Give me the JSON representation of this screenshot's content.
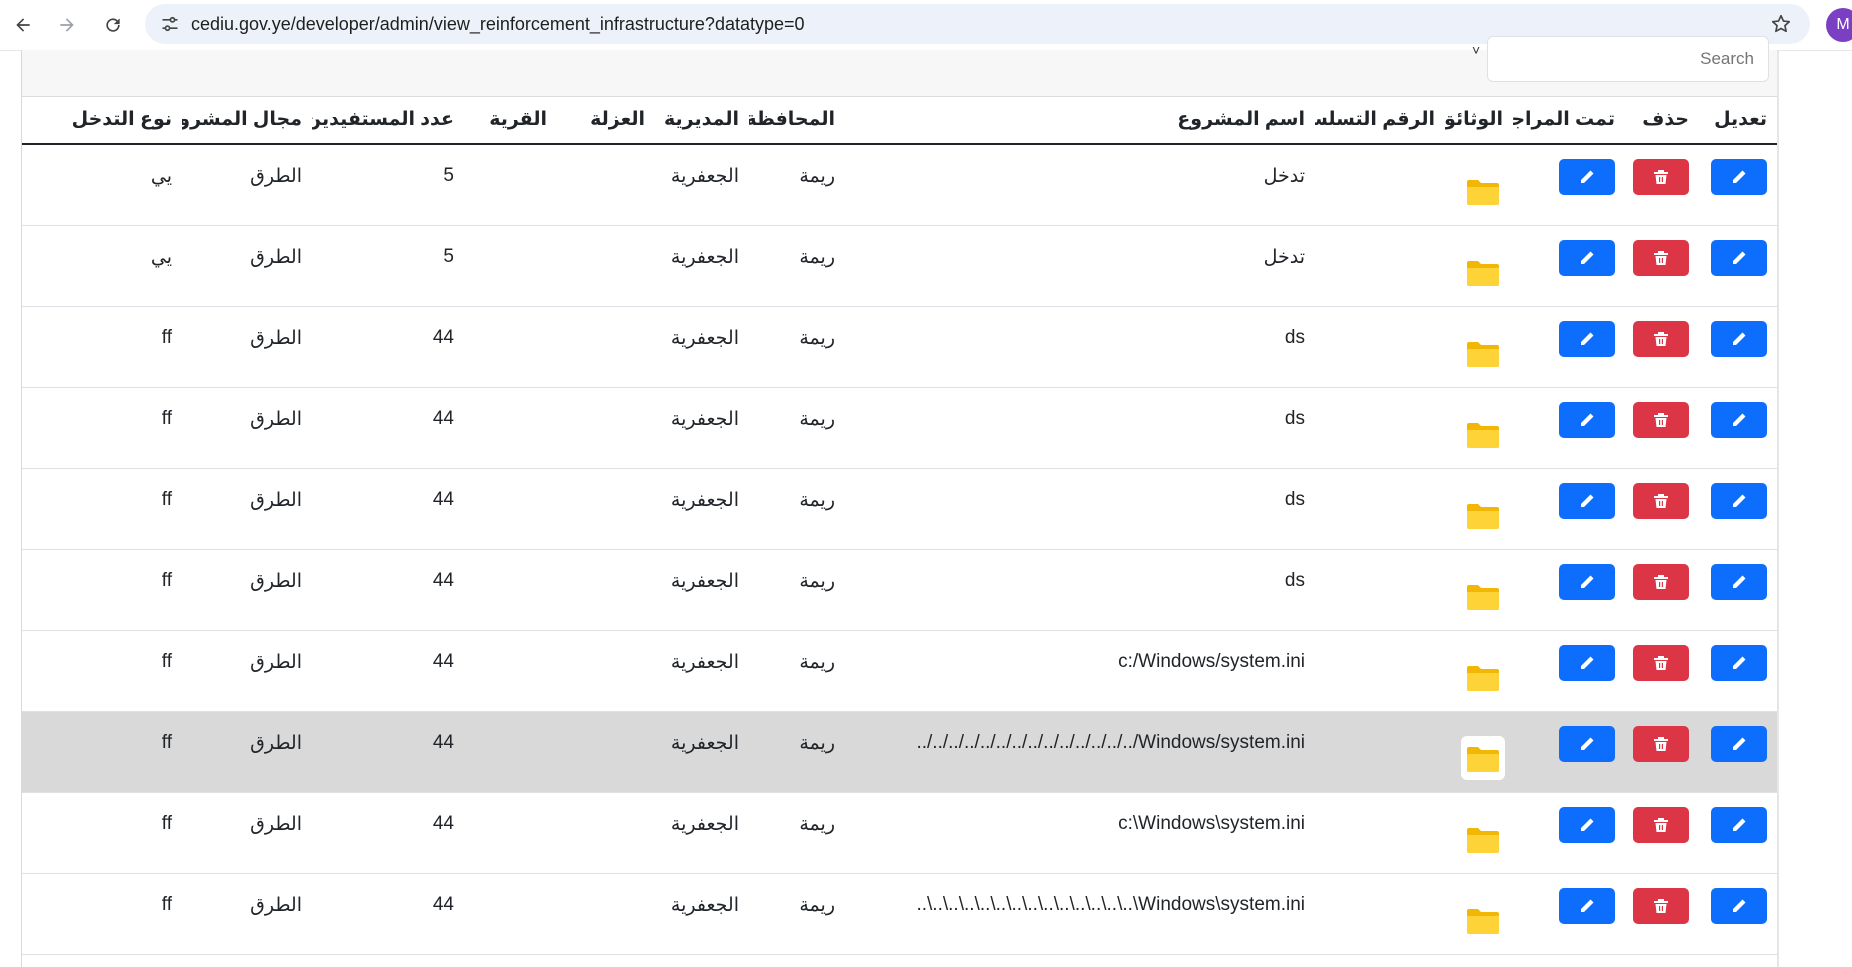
{
  "browser": {
    "url": "cediu.gov.ye/developer/admin/view_reinforcement_infrastructure?datatype=0",
    "profile_initial": "M"
  },
  "search": {
    "placeholder": "Search"
  },
  "table": {
    "headers": {
      "edit": "تعديل",
      "delete": "حذف",
      "reviewed": "تمت المراجعة",
      "documents": "الوثائق",
      "serial": "الرقم التسلسلي",
      "project_name": "اسم المشروع",
      "governorate": "المحافظة",
      "district": "المديرية",
      "sub_district": "العزلة",
      "village": "القرية",
      "beneficiaries": "عدد المستفيدين",
      "project_field": "مجال المشروع",
      "intervention_type": "نوع التدخل"
    },
    "rows": [
      {
        "serial": "",
        "project_name": "تدخل",
        "governorate": "ريمة",
        "district": "الجعفرية",
        "sub_district": "",
        "village": "",
        "beneficiaries": "5",
        "project_field": "الطرق",
        "intervention_type": "يي"
      },
      {
        "serial": "",
        "project_name": "تدخل",
        "governorate": "ريمة",
        "district": "الجعفرية",
        "sub_district": "",
        "village": "",
        "beneficiaries": "5",
        "project_field": "الطرق",
        "intervention_type": "يي"
      },
      {
        "serial": "",
        "project_name": "ds",
        "governorate": "ريمة",
        "district": "الجعفرية",
        "sub_district": "",
        "village": "",
        "beneficiaries": "44",
        "project_field": "الطرق",
        "intervention_type": "ff"
      },
      {
        "serial": "",
        "project_name": "ds",
        "governorate": "ريمة",
        "district": "الجعفرية",
        "sub_district": "",
        "village": "",
        "beneficiaries": "44",
        "project_field": "الطرق",
        "intervention_type": "ff"
      },
      {
        "serial": "",
        "project_name": "ds",
        "governorate": "ريمة",
        "district": "الجعفرية",
        "sub_district": "",
        "village": "",
        "beneficiaries": "44",
        "project_field": "الطرق",
        "intervention_type": "ff"
      },
      {
        "serial": "",
        "project_name": "ds",
        "governorate": "ريمة",
        "district": "الجعفرية",
        "sub_district": "",
        "village": "",
        "beneficiaries": "44",
        "project_field": "الطرق",
        "intervention_type": "ff"
      },
      {
        "serial": "",
        "project_name": "c:/Windows/system.ini",
        "governorate": "ريمة",
        "district": "الجعفرية",
        "sub_district": "",
        "village": "",
        "beneficiaries": "44",
        "project_field": "الطرق",
        "intervention_type": "ff"
      },
      {
        "serial": "",
        "project_name": "../../../../../../../../../../../../../../Windows/system.ini",
        "governorate": "ريمة",
        "district": "الجعفرية",
        "sub_district": "",
        "village": "",
        "beneficiaries": "44",
        "project_field": "الطرق",
        "intervention_type": "ff"
      },
      {
        "serial": "",
        "project_name": "c:\\Windows\\system.ini",
        "governorate": "ريمة",
        "district": "الجعفرية",
        "sub_district": "",
        "village": "",
        "beneficiaries": "44",
        "project_field": "الطرق",
        "intervention_type": "ff"
      },
      {
        "serial": "",
        "project_name": "..\\..\\..\\..\\..\\..\\..\\..\\..\\..\\..\\..\\..\\..\\Windows\\system.ini",
        "governorate": "ريمة",
        "district": "الجعفرية",
        "sub_district": "",
        "village": "",
        "beneficiaries": "44",
        "project_field": "الطرق",
        "intervention_type": "ff"
      }
    ]
  },
  "colors": {
    "primary": "#0d6efd",
    "danger": "#dc3545",
    "folder": "#f9c22e",
    "highlight_row": "#d9d9d9"
  },
  "icons": {
    "edit": "pencil-icon",
    "delete": "trash-icon",
    "documents": "folder-icon"
  }
}
